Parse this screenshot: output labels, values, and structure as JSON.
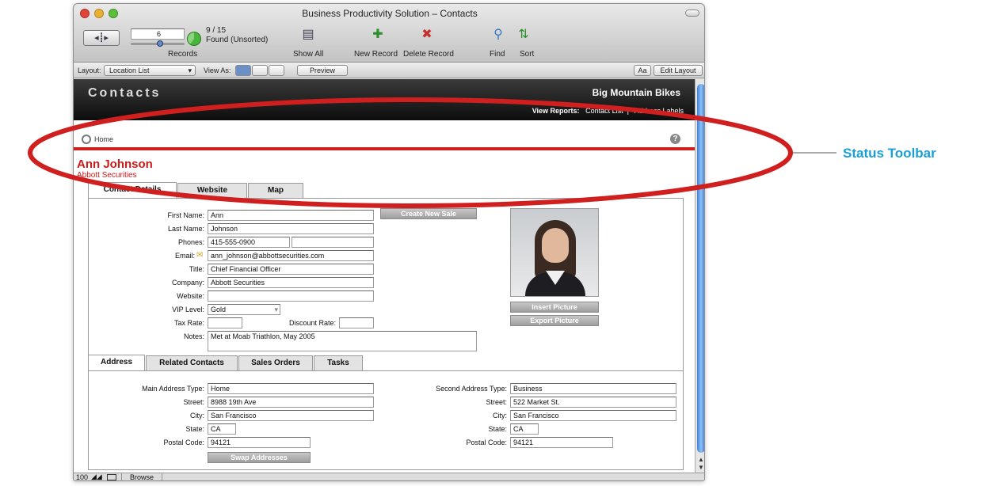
{
  "window": {
    "title": "Business Productivity Solution – Contacts"
  },
  "toolbar": {
    "record_field": "6",
    "record_count": "9 / 15",
    "found_status": "Found (Unsorted)",
    "records_label": "Records",
    "show_all": "Show All",
    "new_record": "New Record",
    "delete_record": "Delete Record",
    "find": "Find",
    "sort": "Sort"
  },
  "layout_bar": {
    "layout_label": "Layout:",
    "layout_value": "Location List",
    "view_as": "View As:",
    "preview": "Preview",
    "aa": "Aa",
    "edit_layout": "Edit Layout"
  },
  "header": {
    "title": "Contacts",
    "company": "Big Mountain Bikes",
    "view_reports_label": "View Reports:",
    "contact_list": "Contact List",
    "address_labels": "Address Labels"
  },
  "status": {
    "home": "Home",
    "help": "?"
  },
  "contact": {
    "name": "Ann Johnson",
    "company": "Abbott Securities"
  },
  "tabs": [
    "Contact Details",
    "Website",
    "Map"
  ],
  "details": {
    "first_name": {
      "label": "First Name:",
      "value": "Ann"
    },
    "last_name": {
      "label": "Last Name:",
      "value": "Johnson"
    },
    "phones": {
      "label": "Phones:",
      "value": "415-555-0900",
      "value2": ""
    },
    "email": {
      "label": "Email:",
      "value": "ann_johnson@abbottsecurities.com"
    },
    "title": {
      "label": "Title:",
      "value": "Chief Financial Officer"
    },
    "company": {
      "label": "Company:",
      "value": "Abbott Securities"
    },
    "website": {
      "label": "Website:",
      "value": ""
    },
    "vip_level": {
      "label": "VIP Level:",
      "value": "Gold"
    },
    "tax_rate": {
      "label": "Tax Rate:",
      "value": ""
    },
    "discount_rate": {
      "label": "Discount Rate:",
      "value": ""
    },
    "notes": {
      "label": "Notes:",
      "value": "Met at Moab Triathlon, May 2005"
    },
    "create_new_sale": "Create New Sale",
    "insert_picture": "Insert Picture",
    "export_picture": "Export Picture"
  },
  "subtabs": [
    "Address",
    "Related Contacts",
    "Sales Orders",
    "Tasks"
  ],
  "address": {
    "main_type": {
      "label": "Main Address Type:",
      "value": "Home"
    },
    "street": {
      "label": "Street:",
      "value": "8988 19th Ave"
    },
    "city": {
      "label": "City:",
      "value": "San Francisco"
    },
    "state": {
      "label": "State:",
      "value": "CA"
    },
    "postal": {
      "label": "Postal Code:",
      "value": "94121"
    },
    "second_type": {
      "label": "Second Address Type:",
      "value": "Business"
    },
    "street2": {
      "label": "Street:",
      "value": "522 Market St."
    },
    "city2": {
      "label": "City:",
      "value": "San Francisco"
    },
    "state2": {
      "label": "State:",
      "value": "CA"
    },
    "postal2": {
      "label": "Postal Code:",
      "value": "94121"
    },
    "swap": "Swap Addresses"
  },
  "bottom": {
    "zoom": "100",
    "mode": "Browse"
  },
  "callout": {
    "label": "Status Toolbar",
    "color": "#d01f1f"
  },
  "colors": {
    "accent_red": "#cc1a1a",
    "callout_blue": "#1aa0d6"
  }
}
